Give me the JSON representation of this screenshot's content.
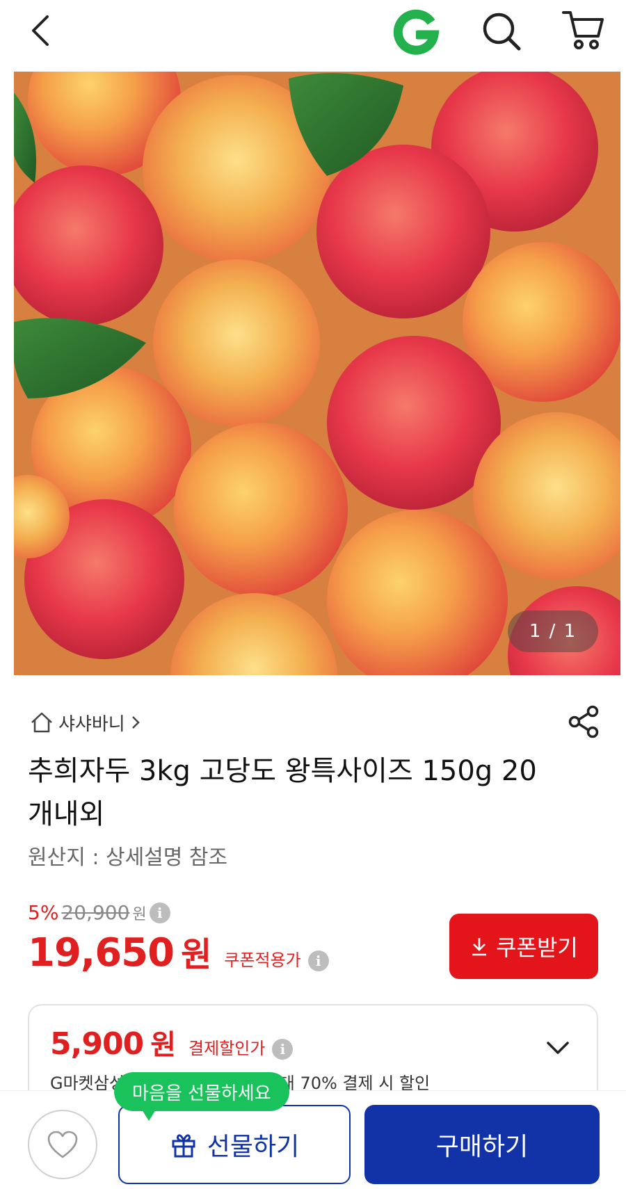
{
  "header": {
    "back_icon": "chevron-left-icon",
    "logo_icon": "gmarket-g-logo",
    "search_icon": "search-icon",
    "cart_icon": "cart-icon"
  },
  "gallery": {
    "counter": "1 / 1",
    "image": "plums-photo"
  },
  "store": {
    "name": "샤샤바니",
    "home_icon": "home-icon",
    "chevron_icon": "chevron-right-icon",
    "share_icon": "share-icon"
  },
  "product": {
    "title": "추희자두 3kg 고당도 왕특사이즈 150g 20개내외",
    "origin": "원산지 : 상세설명 참조"
  },
  "price": {
    "discount_rate": "5%",
    "original_price": "20,900",
    "original_unit": "원",
    "sale_price": "19,650",
    "sale_unit": "원",
    "sale_label": "쿠폰적용가",
    "info_icon": "info-icon"
  },
  "coupon_button": {
    "label": "쿠폰받기",
    "icon": "download-icon"
  },
  "payment_discount": {
    "price": "5,900",
    "unit": "원",
    "label": "결제할인가",
    "description": "G마켓삼성카드 첫 결제 혜택 / 최대 70% 결제 시 할인",
    "chevron_icon": "chevron-down-icon"
  },
  "bottom_bar": {
    "heart_icon": "heart-icon",
    "gift_tooltip": "마음을 선물하세요",
    "gift_label": "선물하기",
    "gift_icon": "gift-icon",
    "buy_label": "구매하기"
  },
  "colors": {
    "accent_red": "#e3151b",
    "brand_blue": "#1233a8",
    "tooltip_green": "#19c25a"
  }
}
